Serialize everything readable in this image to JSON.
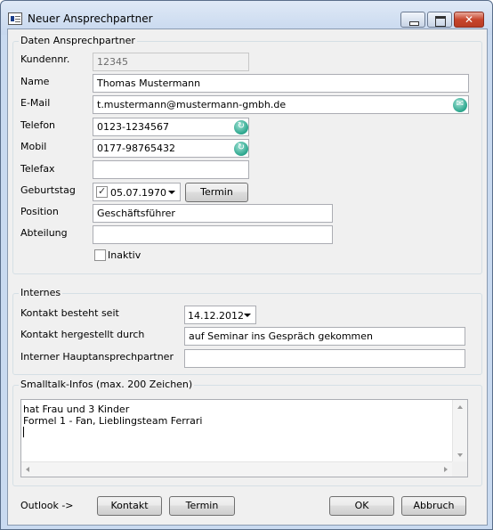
{
  "window": {
    "title": "Neuer Ansprechpartner"
  },
  "contact": {
    "group_label": "Daten Ansprechpartner",
    "customer_no": {
      "label": "Kundennr.",
      "value": "12345"
    },
    "name": {
      "label": "Name",
      "value": "Thomas Mustermann"
    },
    "email": {
      "label": "E-Mail",
      "value": "t.mustermann@mustermann-gmbh.de",
      "icon": "mail-icon"
    },
    "phone": {
      "label": "Telefon",
      "value": "0123-1234567",
      "icon": "dial-icon"
    },
    "mobile": {
      "label": "Mobil",
      "value": "0177-98765432",
      "icon": "dial-icon"
    },
    "fax": {
      "label": "Telefax",
      "value": ""
    },
    "birthday": {
      "label": "Geburtstag",
      "value": "05.07.1970",
      "checked": true,
      "button": "Termin"
    },
    "position": {
      "label": "Position",
      "value": "Geschäftsführer"
    },
    "department": {
      "label": "Abteilung",
      "value": ""
    },
    "inactive": {
      "label": "Inaktiv",
      "checked": false
    }
  },
  "internal": {
    "group_label": "Internes",
    "since": {
      "label": "Kontakt besteht seit",
      "value": "14.12.2012"
    },
    "made_by": {
      "label": "Kontakt hergestellt durch",
      "value": "auf Seminar ins Gespräch gekommen"
    },
    "main_contact": {
      "label": "Interner Hauptansprechpartner",
      "value": ""
    }
  },
  "smalltalk": {
    "group_label": "Smalltalk-Infos (max. 200 Zeichen)",
    "text": "hat Frau und 3 Kinder\nFormel 1 - Fan, Lieblingsteam Ferrari"
  },
  "footer": {
    "outlook_label": "Outlook ->",
    "contact_button": "Kontakt",
    "appointment_button": "Termin",
    "ok_button": "OK",
    "cancel_button": "Abbruch"
  },
  "colors": {
    "accent": "#2aa58c",
    "titlebar": "#c6d7ee",
    "close": "#c7452c"
  }
}
